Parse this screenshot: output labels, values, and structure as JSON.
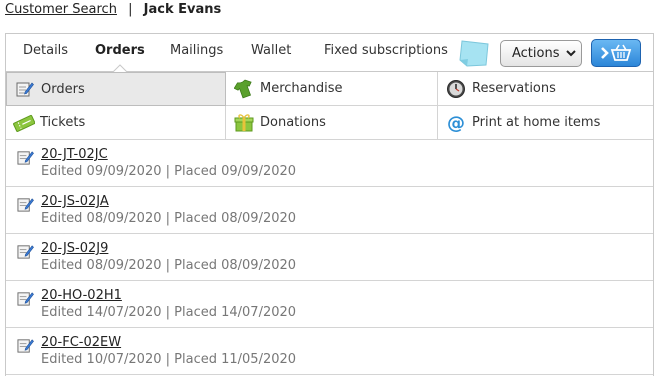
{
  "breadcrumb": {
    "link": "Customer Search",
    "separator": "|",
    "current": "Jack Evans"
  },
  "tabs": [
    "Details",
    "Orders",
    "Mailings",
    "Wallet",
    "Fixed subscriptions"
  ],
  "active_tab": "Orders",
  "actions": {
    "label": "Actions"
  },
  "categories": [
    {
      "label": "Orders",
      "icon": "orders-icon",
      "selected": true
    },
    {
      "label": "Merchandise",
      "icon": "tshirt-icon"
    },
    {
      "label": "Reservations",
      "icon": "clock-icon"
    },
    {
      "label": "Tickets",
      "icon": "ticket-icon"
    },
    {
      "label": "Donations",
      "icon": "gift-icon"
    },
    {
      "label": "Print at home items",
      "icon": "at-icon"
    }
  ],
  "orders": [
    {
      "id": "20-JT-02JC",
      "edited_text": "Edited 09/09/2020",
      "sep": "|",
      "placed_text": "Placed 09/09/2020"
    },
    {
      "id": "20-JS-02JA",
      "edited_text": "Edited 08/09/2020",
      "sep": "|",
      "placed_text": "Placed 08/09/2020"
    },
    {
      "id": "20-JS-02J9",
      "edited_text": "Edited 08/09/2020",
      "sep": "|",
      "placed_text": "Placed 08/09/2020"
    },
    {
      "id": "20-HO-02H1",
      "edited_text": "Edited 14/07/2020",
      "sep": "|",
      "placed_text": "Placed 14/07/2020"
    },
    {
      "id": "20-FC-02EW",
      "edited_text": "Edited 10/07/2020",
      "sep": "|",
      "placed_text": "Placed 11/05/2020"
    }
  ],
  "colors": {
    "accent_blue": "#2c86d8",
    "selected_cell": "#e9e9e9",
    "sticky_note": "#9fe0f0"
  }
}
